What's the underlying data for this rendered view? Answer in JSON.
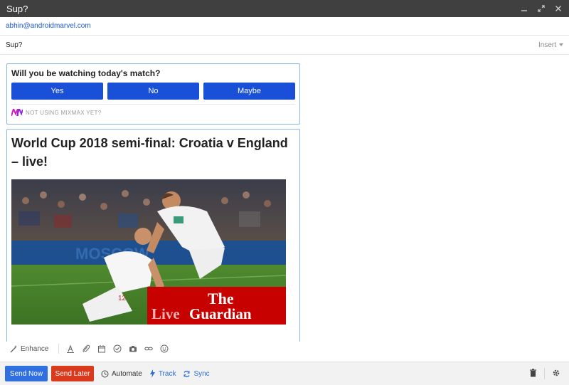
{
  "window": {
    "title": "Sup?"
  },
  "compose": {
    "to": "abhin@androidmarvel.com",
    "subject": "Sup?",
    "insert_label": "Insert"
  },
  "poll": {
    "question": "Will you be watching today's match?",
    "options": [
      "Yes",
      "No",
      "Maybe"
    ],
    "promo": "NOT USING MIXMAX YET?",
    "accent_color": "#1a4fd8"
  },
  "article": {
    "headline": "World Cup 2018 semi-final: Croatia v England – live!",
    "image_badge_line1": "The",
    "image_badge_line2_a": "Live",
    "image_badge_line2_b": "Guardian",
    "jersey_number": "12"
  },
  "format_toolbar": {
    "enhance_label": "Enhance",
    "icons": [
      "text-format-icon",
      "attach-icon",
      "calendar-icon",
      "check-circle-icon",
      "camera-icon",
      "link-icon",
      "emoji-icon"
    ]
  },
  "actions": {
    "send_now": "Send Now",
    "send_later": "Send Later",
    "automate": "Automate",
    "track": "Track",
    "sync": "Sync",
    "send_now_color": "#2f6fe0",
    "send_later_color": "#d93a1e"
  }
}
